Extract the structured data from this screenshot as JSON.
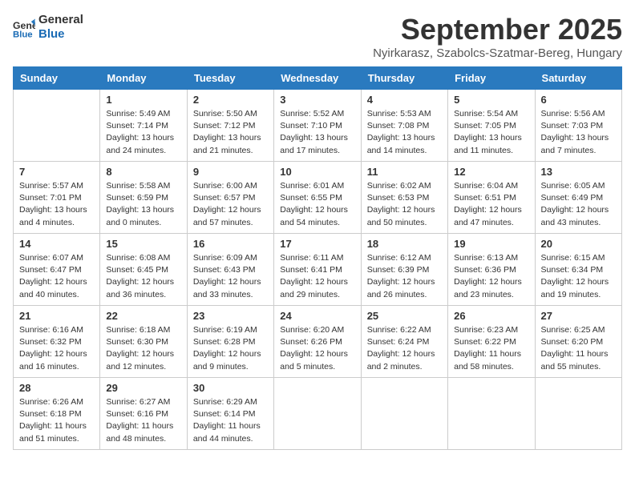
{
  "logo": {
    "line1": "General",
    "line2": "Blue"
  },
  "title": "September 2025",
  "location": "Nyirkarasz, Szabolcs-Szatmar-Bereg, Hungary",
  "days_of_week": [
    "Sunday",
    "Monday",
    "Tuesday",
    "Wednesday",
    "Thursday",
    "Friday",
    "Saturday"
  ],
  "weeks": [
    [
      {
        "day": "",
        "info": ""
      },
      {
        "day": "1",
        "info": "Sunrise: 5:49 AM\nSunset: 7:14 PM\nDaylight: 13 hours\nand 24 minutes."
      },
      {
        "day": "2",
        "info": "Sunrise: 5:50 AM\nSunset: 7:12 PM\nDaylight: 13 hours\nand 21 minutes."
      },
      {
        "day": "3",
        "info": "Sunrise: 5:52 AM\nSunset: 7:10 PM\nDaylight: 13 hours\nand 17 minutes."
      },
      {
        "day": "4",
        "info": "Sunrise: 5:53 AM\nSunset: 7:08 PM\nDaylight: 13 hours\nand 14 minutes."
      },
      {
        "day": "5",
        "info": "Sunrise: 5:54 AM\nSunset: 7:05 PM\nDaylight: 13 hours\nand 11 minutes."
      },
      {
        "day": "6",
        "info": "Sunrise: 5:56 AM\nSunset: 7:03 PM\nDaylight: 13 hours\nand 7 minutes."
      }
    ],
    [
      {
        "day": "7",
        "info": "Sunrise: 5:57 AM\nSunset: 7:01 PM\nDaylight: 13 hours\nand 4 minutes."
      },
      {
        "day": "8",
        "info": "Sunrise: 5:58 AM\nSunset: 6:59 PM\nDaylight: 13 hours\nand 0 minutes."
      },
      {
        "day": "9",
        "info": "Sunrise: 6:00 AM\nSunset: 6:57 PM\nDaylight: 12 hours\nand 57 minutes."
      },
      {
        "day": "10",
        "info": "Sunrise: 6:01 AM\nSunset: 6:55 PM\nDaylight: 12 hours\nand 54 minutes."
      },
      {
        "day": "11",
        "info": "Sunrise: 6:02 AM\nSunset: 6:53 PM\nDaylight: 12 hours\nand 50 minutes."
      },
      {
        "day": "12",
        "info": "Sunrise: 6:04 AM\nSunset: 6:51 PM\nDaylight: 12 hours\nand 47 minutes."
      },
      {
        "day": "13",
        "info": "Sunrise: 6:05 AM\nSunset: 6:49 PM\nDaylight: 12 hours\nand 43 minutes."
      }
    ],
    [
      {
        "day": "14",
        "info": "Sunrise: 6:07 AM\nSunset: 6:47 PM\nDaylight: 12 hours\nand 40 minutes."
      },
      {
        "day": "15",
        "info": "Sunrise: 6:08 AM\nSunset: 6:45 PM\nDaylight: 12 hours\nand 36 minutes."
      },
      {
        "day": "16",
        "info": "Sunrise: 6:09 AM\nSunset: 6:43 PM\nDaylight: 12 hours\nand 33 minutes."
      },
      {
        "day": "17",
        "info": "Sunrise: 6:11 AM\nSunset: 6:41 PM\nDaylight: 12 hours\nand 29 minutes."
      },
      {
        "day": "18",
        "info": "Sunrise: 6:12 AM\nSunset: 6:39 PM\nDaylight: 12 hours\nand 26 minutes."
      },
      {
        "day": "19",
        "info": "Sunrise: 6:13 AM\nSunset: 6:36 PM\nDaylight: 12 hours\nand 23 minutes."
      },
      {
        "day": "20",
        "info": "Sunrise: 6:15 AM\nSunset: 6:34 PM\nDaylight: 12 hours\nand 19 minutes."
      }
    ],
    [
      {
        "day": "21",
        "info": "Sunrise: 6:16 AM\nSunset: 6:32 PM\nDaylight: 12 hours\nand 16 minutes."
      },
      {
        "day": "22",
        "info": "Sunrise: 6:18 AM\nSunset: 6:30 PM\nDaylight: 12 hours\nand 12 minutes."
      },
      {
        "day": "23",
        "info": "Sunrise: 6:19 AM\nSunset: 6:28 PM\nDaylight: 12 hours\nand 9 minutes."
      },
      {
        "day": "24",
        "info": "Sunrise: 6:20 AM\nSunset: 6:26 PM\nDaylight: 12 hours\nand 5 minutes."
      },
      {
        "day": "25",
        "info": "Sunrise: 6:22 AM\nSunset: 6:24 PM\nDaylight: 12 hours\nand 2 minutes."
      },
      {
        "day": "26",
        "info": "Sunrise: 6:23 AM\nSunset: 6:22 PM\nDaylight: 11 hours\nand 58 minutes."
      },
      {
        "day": "27",
        "info": "Sunrise: 6:25 AM\nSunset: 6:20 PM\nDaylight: 11 hours\nand 55 minutes."
      }
    ],
    [
      {
        "day": "28",
        "info": "Sunrise: 6:26 AM\nSunset: 6:18 PM\nDaylight: 11 hours\nand 51 minutes."
      },
      {
        "day": "29",
        "info": "Sunrise: 6:27 AM\nSunset: 6:16 PM\nDaylight: 11 hours\nand 48 minutes."
      },
      {
        "day": "30",
        "info": "Sunrise: 6:29 AM\nSunset: 6:14 PM\nDaylight: 11 hours\nand 44 minutes."
      },
      {
        "day": "",
        "info": ""
      },
      {
        "day": "",
        "info": ""
      },
      {
        "day": "",
        "info": ""
      },
      {
        "day": "",
        "info": ""
      }
    ]
  ]
}
